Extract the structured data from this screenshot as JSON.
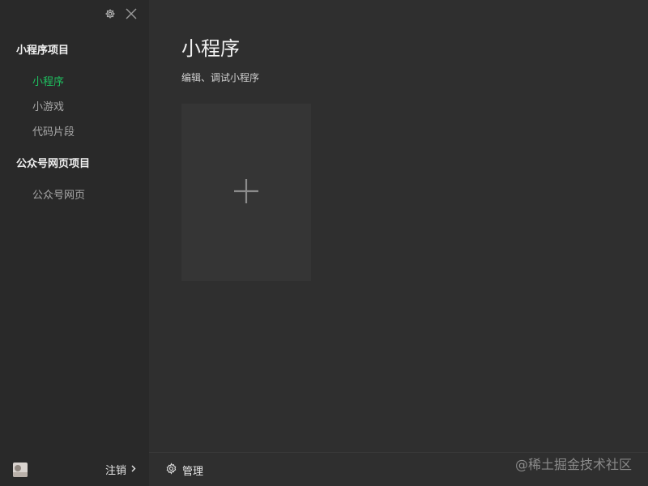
{
  "sidebar": {
    "sections": [
      {
        "title": "小程序项目",
        "items": [
          "小程序",
          "小游戏",
          "代码片段"
        ]
      },
      {
        "title": "公众号网页项目",
        "items": [
          "公众号网页"
        ]
      }
    ],
    "active_item": "小程序",
    "footer": {
      "logout_label": "注销"
    }
  },
  "main": {
    "title": "小程序",
    "subtitle": "编辑、调试小程序",
    "create_icon": "plus-icon"
  },
  "footer": {
    "manage_label": "管理"
  },
  "watermark": "@稀土掘金技术社区",
  "colors": {
    "accent": "#1fbf5f",
    "sidebar_bg": "#292929",
    "main_bg": "#2f2f2f",
    "tile_bg": "#353535"
  }
}
